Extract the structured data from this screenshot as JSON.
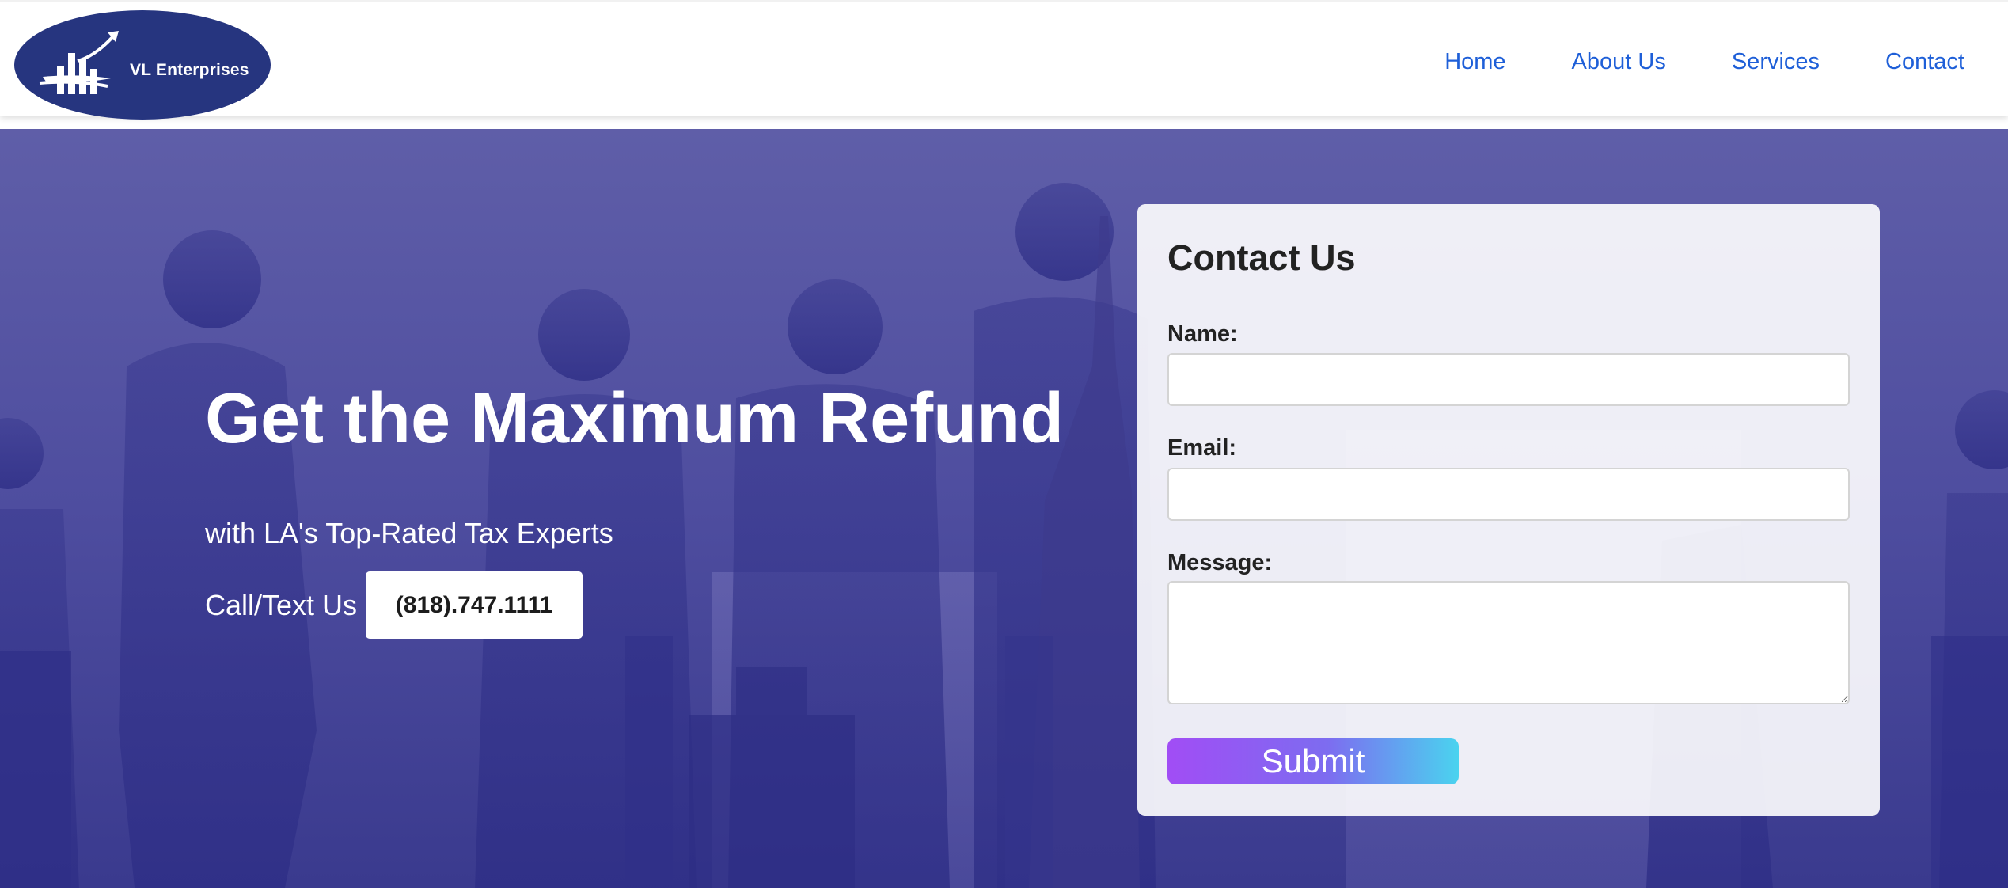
{
  "brand": {
    "name": "VL Enterprises"
  },
  "nav": {
    "items": [
      {
        "label": "Home"
      },
      {
        "label": "About Us"
      },
      {
        "label": "Services"
      },
      {
        "label": "Contact"
      }
    ]
  },
  "hero": {
    "title": "Get the Maximum Refund",
    "subtitle": "with LA's Top-Rated Tax Experts",
    "call_label": "Call/Text Us",
    "phone": "(818).747.1111"
  },
  "contact_form": {
    "title": "Contact Us",
    "name_label": "Name:",
    "name_value": "",
    "email_label": "Email:",
    "email_value": "",
    "message_label": "Message:",
    "message_value": "",
    "submit_label": "Submit"
  },
  "colors": {
    "nav_link": "#1e5fd8",
    "logo_bg": "#26357f",
    "hero_overlay": "#5f5ea8",
    "submit_gradient_start": "#a14df5",
    "submit_gradient_end": "#4ad3ef"
  },
  "icons": {
    "logo": "bar-chart-growth-icon"
  }
}
